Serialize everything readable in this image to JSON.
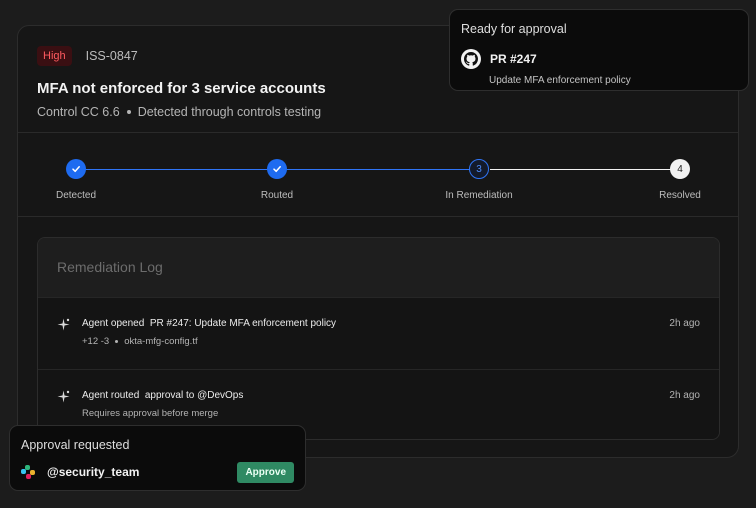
{
  "issue": {
    "severity": "High",
    "id": "ISS-0847",
    "title": "MFA not enforced for 3 service accounts",
    "control": "Control CC 6.6",
    "detection": "Detected through controls testing"
  },
  "stepper": {
    "steps": [
      {
        "label": "Detected",
        "state": "done",
        "marker": "check-icon"
      },
      {
        "label": "Routed",
        "state": "done",
        "marker": "check-icon"
      },
      {
        "label": "In Remediation",
        "state": "current",
        "marker": "3"
      },
      {
        "label": "Resolved",
        "state": "upcoming",
        "marker": "4"
      }
    ],
    "colors": {
      "done": "#1e6bf0",
      "upcoming_line": "#f2f2f2"
    }
  },
  "log": {
    "title": "Remediation Log",
    "items": [
      {
        "icon": "sparkle-icon",
        "actor": "Agent opened",
        "text": "PR #247: Update MFA enforcement policy",
        "diff": "+12 -3",
        "file": "okta-mfg-config.tf",
        "time": "2h ago"
      },
      {
        "icon": "sparkle-icon",
        "actor": "Agent routed",
        "text": "approval to @DevOps",
        "note": "Requires approval before merge",
        "time": "2h ago"
      }
    ]
  },
  "pr_popup": {
    "heading": "Ready for approval",
    "icon": "github-icon",
    "pr_title": "PR #247",
    "pr_desc": "Update MFA enforcement policy"
  },
  "approval_popup": {
    "heading": "Approval requested",
    "icon": "slack-icon",
    "team": "@security_team",
    "button": "Approve",
    "button_color": "#2f8a63"
  }
}
